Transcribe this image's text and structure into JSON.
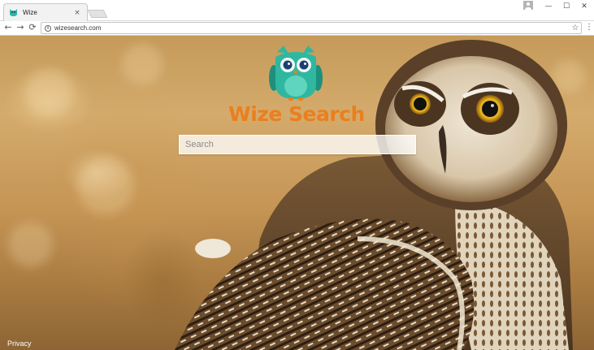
{
  "browser": {
    "tab_title": "Wize",
    "tab_close": "×",
    "url": "wizesearch.com",
    "window_controls": {
      "minimize": "—",
      "maximize": "☐",
      "close": "✕"
    }
  },
  "toolbar_icons": {
    "back": "←",
    "forward": "→",
    "reload": "⟳",
    "info": "i",
    "star": "☆",
    "menu": "⋮"
  },
  "page": {
    "brand_title": "Wize Search",
    "search_placeholder": "Search",
    "privacy_label": "Privacy"
  },
  "colors": {
    "brand_orange": "#ea7f1f",
    "owl_logo_teal": "#2fb7a0"
  }
}
